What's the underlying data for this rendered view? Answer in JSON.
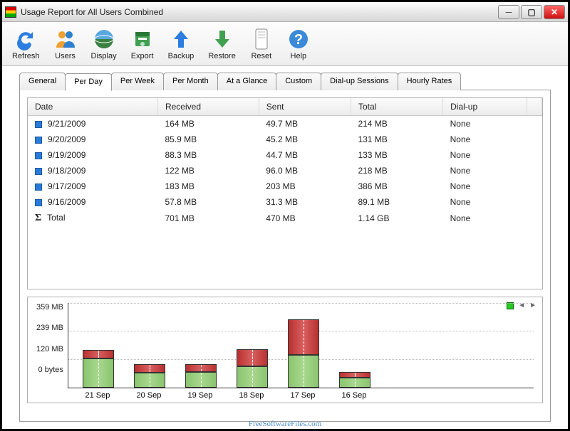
{
  "window": {
    "title": "Usage Report for All Users Combined"
  },
  "toolbar": [
    {
      "label": "Refresh",
      "icon": "refresh"
    },
    {
      "label": "Users",
      "icon": "users"
    },
    {
      "label": "Display",
      "icon": "display"
    },
    {
      "label": "Export",
      "icon": "export"
    },
    {
      "label": "Backup",
      "icon": "backup"
    },
    {
      "label": "Restore",
      "icon": "restore"
    },
    {
      "label": "Reset",
      "icon": "reset"
    },
    {
      "label": "Help",
      "icon": "help"
    }
  ],
  "tabs": [
    {
      "label": "General"
    },
    {
      "label": "Per Day",
      "active": true
    },
    {
      "label": "Per Week"
    },
    {
      "label": "Per Month"
    },
    {
      "label": "At a Glance"
    },
    {
      "label": "Custom"
    },
    {
      "label": "Dial-up Sessions"
    },
    {
      "label": "Hourly Rates"
    }
  ],
  "columns": [
    "Date",
    "Received",
    "Sent",
    "Total",
    "Dial-up"
  ],
  "rows": [
    {
      "date": "9/21/2009",
      "received": "164 MB",
      "sent": "49.7 MB",
      "total": "214 MB",
      "dialup": "None"
    },
    {
      "date": "9/20/2009",
      "received": "85.9 MB",
      "sent": "45.2 MB",
      "total": "131 MB",
      "dialup": "None"
    },
    {
      "date": "9/19/2009",
      "received": "88.3 MB",
      "sent": "44.7 MB",
      "total": "133 MB",
      "dialup": "None"
    },
    {
      "date": "9/18/2009",
      "received": "122 MB",
      "sent": "96.0 MB",
      "total": "218 MB",
      "dialup": "None"
    },
    {
      "date": "9/17/2009",
      "received": "183 MB",
      "sent": "203 MB",
      "total": "386 MB",
      "dialup": "None"
    },
    {
      "date": "9/16/2009",
      "received": "57.8 MB",
      "sent": "31.3 MB",
      "total": "89.1 MB",
      "dialup": "None"
    }
  ],
  "total_row": {
    "label": "Total",
    "received": "701 MB",
    "sent": "470 MB",
    "total": "1.14 GB",
    "dialup": "None"
  },
  "chart_data": {
    "type": "bar",
    "categories": [
      "21 Sep",
      "20 Sep",
      "19 Sep",
      "18 Sep",
      "17 Sep",
      "16 Sep"
    ],
    "series": [
      {
        "name": "Received",
        "values": [
          164,
          85.9,
          88.3,
          122,
          183,
          57.8
        ],
        "color": "#8ac46f"
      },
      {
        "name": "Sent",
        "values": [
          49.7,
          45.2,
          44.7,
          96.0,
          203,
          31.3
        ],
        "color": "#b83030"
      }
    ],
    "y_ticks": [
      "359 MB",
      "239 MB",
      "120 MB",
      "0 bytes"
    ],
    "ylim": [
      0,
      400
    ],
    "ylabel": "",
    "xlabel": "",
    "title": ""
  },
  "watermark": "FreeSoftwareFiles.com"
}
